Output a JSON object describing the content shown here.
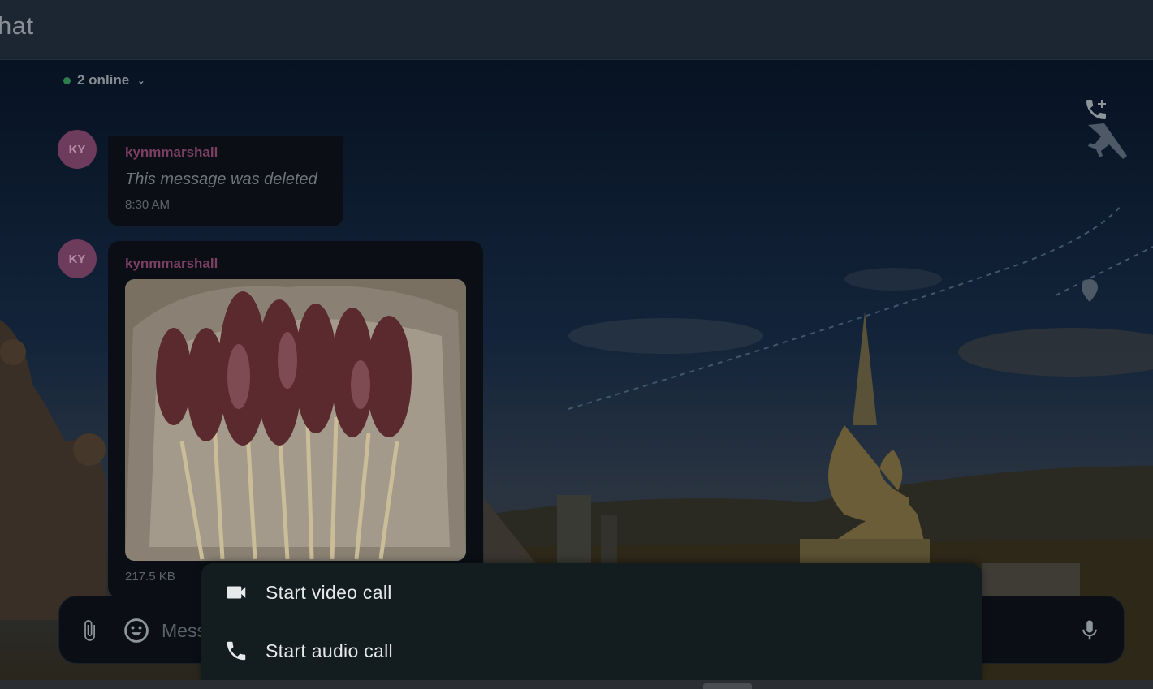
{
  "header": {
    "title": "hat"
  },
  "presence": {
    "label": "2 online"
  },
  "messages": [
    {
      "avatar": "KY",
      "sender": "kynmmarshall",
      "text": "This message was deleted",
      "time": "8:30 AM"
    },
    {
      "avatar": "KY",
      "sender": "kynmmarshall",
      "file_size": "217.5 KB"
    }
  ],
  "composer": {
    "placeholder": "Message"
  },
  "call_menu": {
    "items": [
      {
        "label": "Start video call",
        "icon": "videocam-icon"
      },
      {
        "label": "Start audio call",
        "icon": "phone-icon"
      }
    ]
  },
  "icons": {
    "add_call": "add-call-icon",
    "attach": "paperclip-icon",
    "emoji": "emoji-icon",
    "mic": "mic-icon"
  },
  "colors": {
    "online": "#2e7d4f",
    "avatar": "#6d3b5c",
    "sender": "#7b3f63",
    "menu_bg": "#131c1f"
  }
}
